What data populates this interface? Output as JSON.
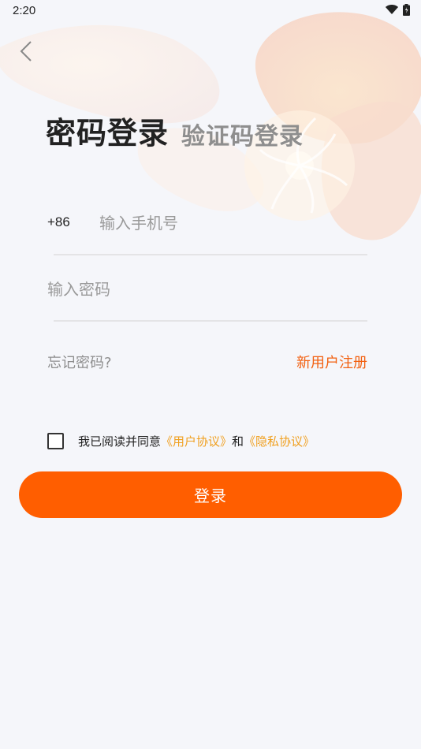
{
  "status_bar": {
    "time": "2:20",
    "icons": [
      "wifi-icon",
      "battery-icon"
    ]
  },
  "nav": {
    "back_icon": "chevron-left-icon"
  },
  "tabs": {
    "password_login": "密码登录",
    "code_login": "验证码登录"
  },
  "form": {
    "country_code": "+86",
    "phone_placeholder": "输入手机号",
    "phone_value": "",
    "password_placeholder": "输入密码",
    "password_value": "",
    "forgot_password": "忘记密码?",
    "register": "新用户注册"
  },
  "agreement": {
    "checked": false,
    "prefix": "我已阅读并同意",
    "user_agreement": "《用户协议》",
    "conjunction": "和",
    "privacy_policy": "《隐私协议》"
  },
  "actions": {
    "login_label": "登录"
  },
  "colors": {
    "accent": "#ff5e00",
    "register_link": "#f26010",
    "agreement_link": "#f0a020",
    "background": "#f5f6fa"
  }
}
